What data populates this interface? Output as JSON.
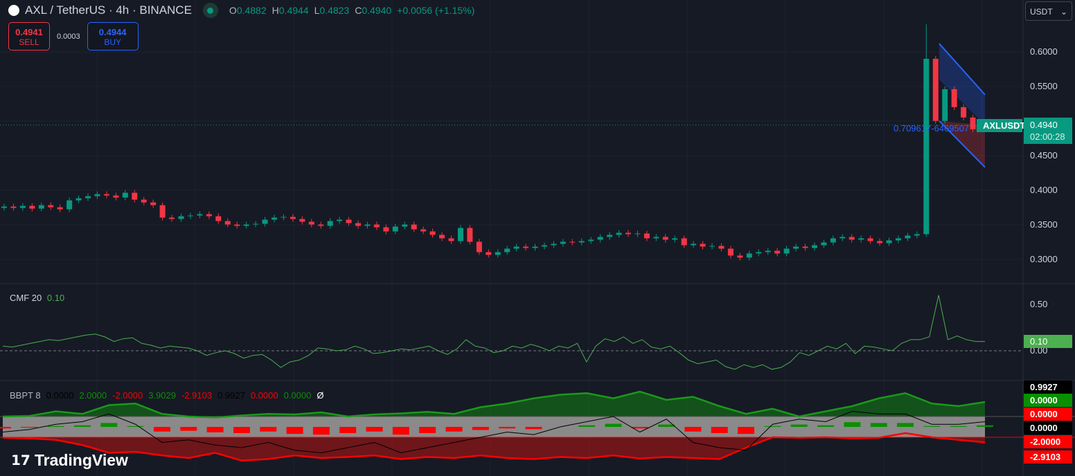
{
  "header": {
    "symbol": "AXL / TetherUS · 4h · BINANCE",
    "logo_glyph": "✖",
    "o_label": "O",
    "o": "0.4882",
    "h_label": "H",
    "h": "0.4944",
    "l_label": "L",
    "l": "0.4823",
    "c_label": "C",
    "c": "0.4940",
    "change": "+0.0056 (+1.15%)"
  },
  "trade": {
    "sell_price": "0.4941",
    "sell_label": "SELL",
    "spread": "0.0003",
    "buy_price": "0.4944",
    "buy_label": "BUY"
  },
  "currency": {
    "label": "USDT",
    "chevron": "⌄"
  },
  "price_axis": [
    "0.6000",
    "0.5500",
    "0.5000",
    "0.4500",
    "0.4000",
    "0.3500",
    "0.3000"
  ],
  "last_price": {
    "symbol": "AXLUSDT",
    "price": "0.4940",
    "countdown": "02:00:28",
    "pattern_text": "0.709617-6469507"
  },
  "colors": {
    "up": "#089981",
    "down": "#f23645",
    "bg": "#161a25",
    "blue": "#2962ff"
  },
  "chart_data": [
    {
      "type": "candlestick",
      "title": "AXL / TetherUS 4h",
      "ylim": [
        0.28,
        0.65
      ],
      "closes": [
        0.376,
        0.374,
        0.377,
        0.373,
        0.378,
        0.375,
        0.372,
        0.385,
        0.388,
        0.391,
        0.394,
        0.392,
        0.389,
        0.396,
        0.386,
        0.382,
        0.378,
        0.36,
        0.358,
        0.362,
        0.363,
        0.365,
        0.362,
        0.355,
        0.35,
        0.348,
        0.35,
        0.351,
        0.357,
        0.36,
        0.361,
        0.358,
        0.354,
        0.35,
        0.348,
        0.355,
        0.357,
        0.352,
        0.348,
        0.35,
        0.346,
        0.34,
        0.347,
        0.35,
        0.343,
        0.34,
        0.335,
        0.33,
        0.326,
        0.345,
        0.325,
        0.31,
        0.306,
        0.31,
        0.315,
        0.318,
        0.316,
        0.318,
        0.32,
        0.322,
        0.325,
        0.324,
        0.326,
        0.328,
        0.332,
        0.335,
        0.338,
        0.336,
        0.337,
        0.33,
        0.332,
        0.328,
        0.33,
        0.32,
        0.322,
        0.318,
        0.319,
        0.315,
        0.305,
        0.302,
        0.308,
        0.31,
        0.312,
        0.308,
        0.315,
        0.318,
        0.316,
        0.32,
        0.324,
        0.33,
        0.332,
        0.328,
        0.33,
        0.326,
        0.323,
        0.327,
        0.33,
        0.334,
        0.336,
        0.59,
        0.5,
        0.546,
        0.52,
        0.505,
        0.488,
        0.494
      ],
      "channel": {
        "upper": [
          0.612,
          0.538
        ],
        "lower": [
          0.5,
          0.433
        ]
      }
    },
    {
      "type": "line",
      "title": "CMF 20",
      "value_label": "0.10",
      "yticks": [
        "0.50",
        "0.00"
      ],
      "ylim": [
        -0.25,
        0.65
      ],
      "values": [
        0.05,
        0.04,
        0.06,
        0.08,
        0.1,
        0.12,
        0.11,
        0.13,
        0.15,
        0.17,
        0.18,
        0.15,
        0.1,
        0.13,
        0.14,
        0.08,
        0.06,
        0.03,
        0.05,
        0.04,
        0.03,
        0.0,
        -0.05,
        -0.02,
        0.0,
        -0.03,
        -0.08,
        -0.05,
        -0.04,
        -0.1,
        -0.18,
        -0.12,
        -0.1,
        -0.05,
        0.03,
        0.02,
        0.0,
        0.01,
        0.05,
        0.02,
        -0.03,
        -0.02,
        0.0,
        0.02,
        0.01,
        0.03,
        0.05,
        0.0,
        -0.04,
        0.02,
        0.12,
        0.05,
        0.03,
        -0.02,
        0.0,
        0.05,
        0.03,
        0.07,
        0.04,
        0.0,
        0.05,
        0.03,
        0.08,
        -0.12,
        0.05,
        0.13,
        0.1,
        0.15,
        0.08,
        0.12,
        0.04,
        0.02,
        0.05,
        -0.02,
        -0.1,
        -0.14,
        -0.12,
        -0.1,
        -0.17,
        -0.2,
        -0.15,
        -0.18,
        -0.15,
        -0.2,
        -0.18,
        -0.12,
        -0.02,
        -0.05,
        0.0,
        0.05,
        0.02,
        0.08,
        -0.03,
        0.05,
        0.04,
        0.02,
        0.0,
        0.08,
        0.12,
        0.12,
        0.15,
        0.6,
        0.12,
        0.16,
        0.12,
        0.1,
        0.1
      ]
    },
    {
      "type": "area",
      "title": "BBPT 8",
      "legend": [
        "0.0000",
        "2.0000",
        "-2.0000",
        "3.9029",
        "-2.9103",
        "0.9927",
        "0.0000",
        "0.0000",
        "Ø"
      ],
      "axis_labels": [
        "0.9927",
        "0.0000",
        "0.0000",
        "0.0000",
        "-2.0000",
        "-2.9103"
      ],
      "ylim": [
        -7,
        7
      ],
      "band": [
        2,
        -2
      ],
      "upper": [
        2,
        2.1,
        3,
        2.5,
        4.2,
        4.5,
        2.5,
        2,
        1.8,
        2.2,
        2.5,
        2.4,
        2.8,
        2,
        2.4,
        2.6,
        2.9,
        2.5,
        3.8,
        4.5,
        5.5,
        6.2,
        6.5,
        5.5,
        6.8,
        5.2,
        5.8,
        4,
        2.5,
        3.5,
        2,
        3,
        4,
        5.5,
        6.5,
        4.5,
        4,
        4.8
      ],
      "lower": [
        -2.1,
        -2.2,
        -2.5,
        -3.5,
        -5,
        -4.8,
        -5.5,
        -6,
        -5,
        -6.5,
        -6.2,
        -5.5,
        -6,
        -5.8,
        -5.5,
        -6.2,
        -5.8,
        -6,
        -5.5,
        -6,
        -6.2,
        -5.8,
        -6,
        -5.5,
        -6.1,
        -5.8,
        -6,
        -6.2,
        -4,
        -2,
        -2.1,
        -2,
        -2.2,
        -2.1,
        -1.2,
        -2,
        -2.5,
        -3
      ],
      "bbp": [
        -1,
        -0.5,
        0.5,
        1,
        2.5,
        0.5,
        -3,
        -2.5,
        -3.5,
        -4,
        -3,
        -4.5,
        -5,
        -4,
        -3,
        -5,
        -4,
        -3,
        -2,
        -1,
        -1.5,
        0,
        1,
        2,
        -1,
        1.5,
        -3,
        -4,
        -4.5,
        0.5,
        1.5,
        1,
        3,
        2.5,
        2.5,
        0.5,
        0.5,
        1
      ]
    }
  ],
  "branding": {
    "name": "TradingView"
  }
}
